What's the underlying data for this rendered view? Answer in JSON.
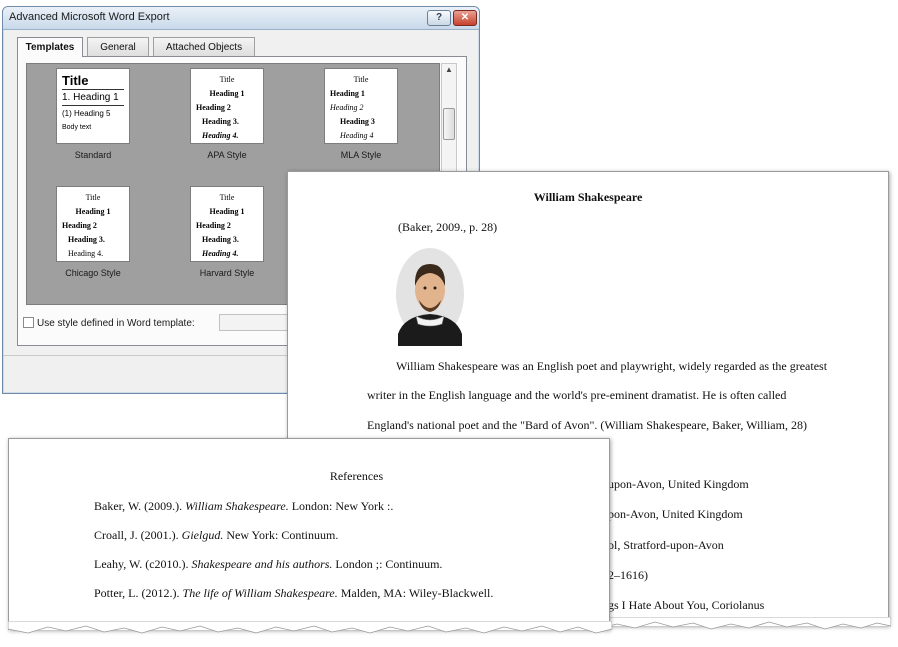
{
  "dialog": {
    "title": "Advanced Microsoft Word Export",
    "help_label": "?",
    "close_label": "✕",
    "tabs": [
      "Templates",
      "General",
      "Attached Objects"
    ],
    "templates": [
      {
        "name": "Standard",
        "lines": [
          "Title",
          "1. Heading 1",
          "(1) Heading 5",
          "Body text"
        ]
      },
      {
        "name": "APA Style",
        "lines": [
          "Title",
          "Heading 1",
          "Heading 2",
          "Heading 3.",
          "Heading 4."
        ]
      },
      {
        "name": "MLA Style",
        "lines": [
          "Title",
          "Heading 1",
          "Heading 2",
          "Heading 3",
          "Heading 4"
        ]
      },
      {
        "name": "Chicago Style",
        "lines": [
          "Title",
          "Heading 1",
          "Heading 2",
          "Heading 3.",
          "Heading 4."
        ]
      },
      {
        "name": "Harvard Style",
        "lines": [
          "Title",
          "Heading 1",
          "Heading 2",
          "Heading 3.",
          "Heading 4."
        ]
      }
    ],
    "checkbox_label": "Use style defined in Word template:",
    "checkbox_checked": false
  },
  "document": {
    "heading": "William Shakespeare",
    "citation": "(Baker, 2009., p. 28)",
    "body_lines": [
      "William Shakespeare was an English poet and playwright, widely regarded as the greatest",
      "writer in the English language and the world's pre-eminent dramatist. He is often called",
      "England's national poet and the \"Bard of Avon\". (William Shakespeare, Baker, William, 28)"
    ],
    "partial_lines": [
      "upon-Avon, United Kingdom",
      "pon-Avon, United Kingdom",
      "ol, Stratford-upon-Avon",
      "2–1616)",
      "gs I Hate About You, Coriolanus"
    ]
  },
  "references": {
    "heading": "References",
    "entries": [
      {
        "before": "Baker, W. (2009.). ",
        "title": "William Shakespeare.",
        "after": " London: New York :."
      },
      {
        "before": "Croall, J. (2001.). ",
        "title": "Gielgud.",
        "after": " New York: Continuum."
      },
      {
        "before": "Leahy, W. (c2010.). ",
        "title": "Shakespeare and his authors.",
        "after": " London ;: Continuum."
      },
      {
        "before": "Potter, L. (2012.). ",
        "title": "The life of William Shakespeare.",
        "after": " Malden, MA: Wiley-Blackwell."
      }
    ]
  },
  "icons": {
    "portrait": "shakespeare-portrait-icon",
    "scroll_up": "scroll-up-arrow-icon",
    "scroll_down": "scroll-down-arrow-icon"
  }
}
